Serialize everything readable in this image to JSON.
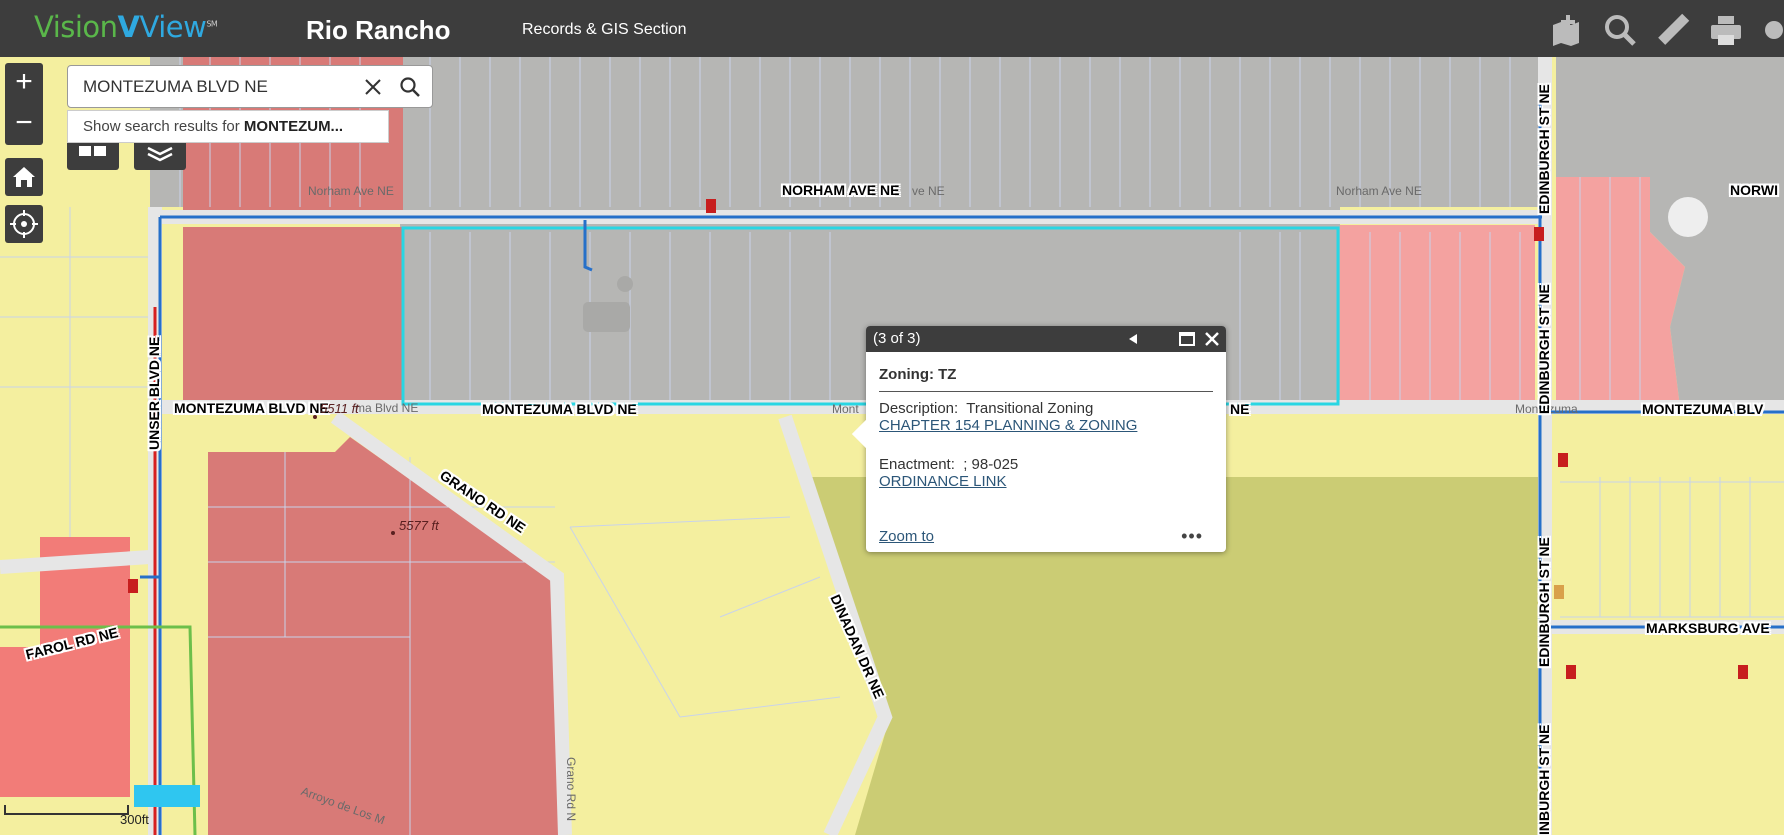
{
  "header": {
    "logo": {
      "part1": "Vision",
      "part2": "V",
      "part3": "View",
      "mark": "SM"
    },
    "city": "Rio Rancho",
    "section": "Records & GIS Section",
    "tools": [
      "add-data-icon",
      "search-tool-icon",
      "measure-icon",
      "print-icon",
      "share-icon"
    ]
  },
  "search": {
    "value": "MONTEZUMA BLVD NE",
    "suggestion_prefix": "Show search results for ",
    "suggestion_term": "MONTEZUM..."
  },
  "controls": {
    "zoom_in": "+",
    "zoom_out": "−"
  },
  "popup": {
    "counter": "(3 of 3)",
    "title": "Zoning: TZ",
    "description_label": "Description:",
    "description_value": "Transitional Zoning",
    "chapter_link": "CHAPTER 154 PLANNING & ZONING",
    "enactment_label": "Enactment:",
    "enactment_value": "; 98-025",
    "ordinance_link": "ORDINANCE LINK",
    "zoom_to": "Zoom to",
    "more": "•••"
  },
  "map": {
    "roads": {
      "norham": "NORHAM AVE NE",
      "norham_gray1": "Norham Ave NE",
      "norham_gray2": "ve NE",
      "norham_gray3": "Norham Ave NE",
      "norwi": "NORWI",
      "unser": "UNSER BLVD NE",
      "montezuma1": "MONTEZUMA BLVD NE",
      "montezuma_gray1": "ma Blvd NE",
      "montezuma2": "MONTEZUMA BLVD NE",
      "montezuma_gray2": "Mont",
      "montezuma3": "NE",
      "montezuma_gray3": "Montezuma",
      "montezuma4": "MONTEZUMA BLV",
      "edinburgh1": "EDINBURGH ST NE",
      "edinburgh2": "EDINBURGH ST NE",
      "edinburgh3": "EDINBURGH ST NE",
      "edinburgh4": "INBURGH ST NE",
      "grano": "GRANO RD NE",
      "grano_gray": "Grano Rd N",
      "dinadan": "DINADAN DR NE",
      "farol": "FAROL RD NE",
      "marksburg": "MARKSBURG AVE",
      "arroyo": "Arroyo de Los M"
    },
    "elevations": {
      "e1": "5511 ft",
      "e2": "5577 ft"
    }
  },
  "scale": {
    "label": "300ft"
  }
}
